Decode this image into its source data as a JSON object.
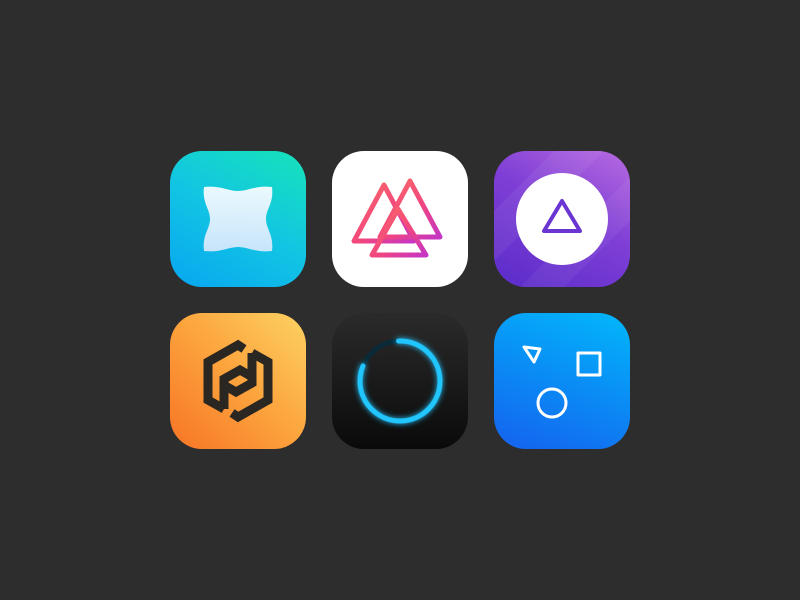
{
  "icons": [
    {
      "id": "t1",
      "name": "star-shape-app-icon",
      "symbol": "four-point-star",
      "colors": [
        "#08a6f0",
        "#17e3b9"
      ]
    },
    {
      "id": "t2",
      "name": "triangles-app-icon",
      "symbol": "interlocked-triangles",
      "colors": [
        "#ffffff",
        "#f6507a",
        "#c837c0"
      ]
    },
    {
      "id": "t3",
      "name": "circle-triangle-app-icon",
      "symbol": "triangle-in-circle",
      "colors": [
        "#b86be0",
        "#5a2bc9"
      ]
    },
    {
      "id": "t4",
      "name": "hexagon-link-app-icon",
      "symbol": "hexagon-link",
      "colors": [
        "#fdd262",
        "#f87426"
      ]
    },
    {
      "id": "t5",
      "name": "progress-ring-app-icon",
      "symbol": "glowing-ring",
      "colors": [
        "#0a0a0a",
        "#20c4ff"
      ]
    },
    {
      "id": "t6",
      "name": "shapes-app-icon",
      "symbol": "triangle-square-circle",
      "colors": [
        "#02b8fb",
        "#1562ee"
      ]
    }
  ]
}
